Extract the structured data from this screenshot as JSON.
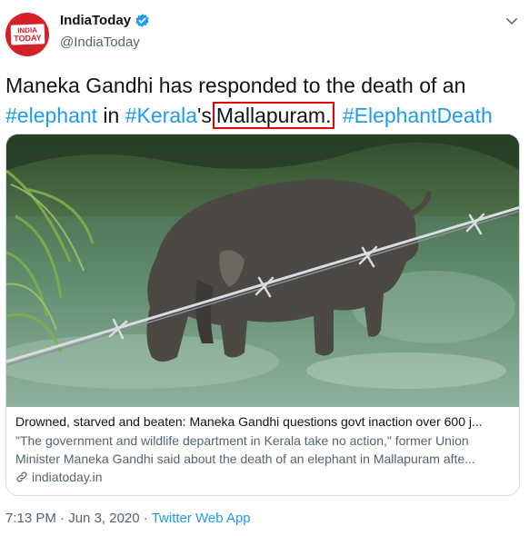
{
  "author": {
    "display_name": "IndiaToday",
    "handle": "@IndiaToday",
    "logo_line1": "INDIA",
    "logo_line2": "TODAY",
    "brand_color": "#d62027",
    "verified": true
  },
  "tweet": {
    "text_parts": [
      "Maneka Gandhi has responded to the death of an",
      "#elephant",
      " in ",
      "#Kerala",
      "'s",
      "Mallapuram.",
      " ",
      "#ElephantDeath"
    ],
    "highlight_color": "#e60000",
    "hashtag_color": "#1d9bf0"
  },
  "card": {
    "title": "Drowned, starved and beaten: Maneka Gandhi questions govt inaction over 600 j...",
    "description_line1": "\"The government and wildlife department in Kerala take no action,\" former Union",
    "description_line2": "Minister Maneka Gandhi said about the death of an elephant in Mallapuram afte...",
    "domain": "indiatoday.in",
    "image_icon": "elephant-in-river-photo"
  },
  "meta": {
    "time": "7:13 PM",
    "sep1": "·",
    "date": "Jun 3, 2020",
    "sep2": "·",
    "source": "Twitter Web App"
  }
}
